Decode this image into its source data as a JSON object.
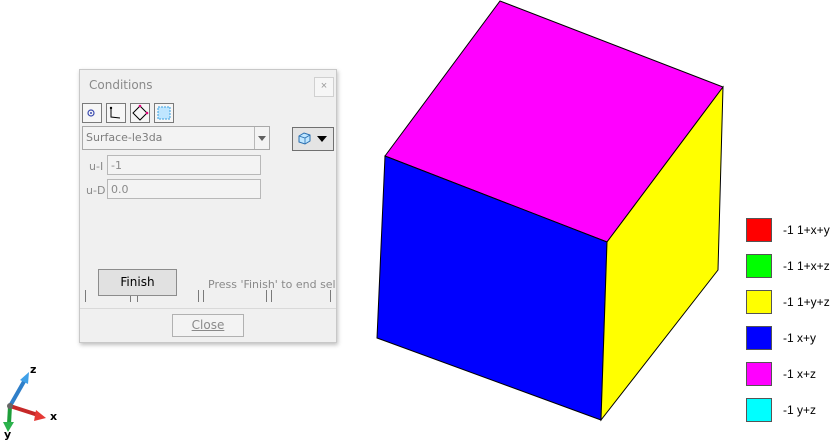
{
  "legend": {
    "items": [
      {
        "label": "-1 1+x+y",
        "color": "#ff0000"
      },
      {
        "label": "-1 1+x+z",
        "color": "#00ff00"
      },
      {
        "label": "-1 1+y+z",
        "color": "#ffff00"
      },
      {
        "label": "-1 x+y",
        "color": "#0000ff"
      },
      {
        "label": "-1 x+z",
        "color": "#ff00ff"
      },
      {
        "label": "-1 y+z",
        "color": "#00ffff"
      }
    ]
  },
  "cube": {
    "top_color": "#ff00ff",
    "front_color": "#0000ff",
    "side_color": "#ffff00"
  },
  "dialog": {
    "title": "Conditions",
    "close_x": "×",
    "tools": [
      "point-tool-icon",
      "line-tool-icon",
      "surface-tool-icon",
      "volume-tool-icon"
    ],
    "condition_select": "Surface-le3da",
    "fields": [
      {
        "label": "u-I",
        "value": "-1"
      },
      {
        "label": "u-D",
        "value": "0.0"
      }
    ],
    "finish_label": "Finish",
    "hint": "Press 'Finish' to end sele",
    "close_label": "Close"
  },
  "triad": {
    "z_label": "z",
    "x_label": "x",
    "y_label": "y"
  }
}
